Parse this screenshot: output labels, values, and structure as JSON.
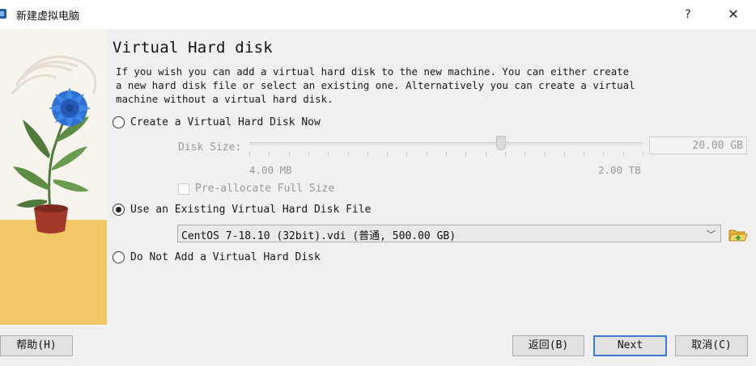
{
  "window": {
    "title": "新建虚拟电脑",
    "help_glyph": "?",
    "close_glyph": "✕",
    "icon": "virtualbox-icon"
  },
  "page": {
    "heading": "Virtual Hard disk",
    "description_lines": [
      "If you wish you can add a virtual hard disk to the new machine. You can either create",
      "a new hard disk file or select an existing one. Alternatively you can create a virtual",
      "machine without a virtual hard disk."
    ]
  },
  "options": {
    "create_new": {
      "label": "Create a Virtual Hard Disk Now",
      "checked": false
    },
    "use_existing": {
      "label": "Use an Existing Virtual Hard Disk File",
      "checked": true
    },
    "no_disk": {
      "label": "Do Not Add a Virtual Hard Disk",
      "checked": false
    }
  },
  "disk_size": {
    "label": "Disk Size:",
    "value": "20.00 GB",
    "min_label": "4.00 MB",
    "max_label": "2.00 TB",
    "slider_fraction": 0.64,
    "preallocate_label": "Pre-allocate Full Size",
    "enabled": false
  },
  "existing_disk": {
    "selected": "CentOS 7-18.10 (32bit).vdi (普通, 500.00 GB)",
    "arrow": "﹀",
    "folder_icon": "folder-open-icon"
  },
  "buttons": {
    "help": "帮助(H)",
    "back": "返回(B)",
    "next": "Next",
    "cancel": "取消(C)"
  },
  "colors": {
    "accent": "#3a7bd5",
    "flower": "#2f6fd1",
    "pot": "#a3382b",
    "floor": "#f2c866",
    "leaf": "#4f7a3c"
  }
}
